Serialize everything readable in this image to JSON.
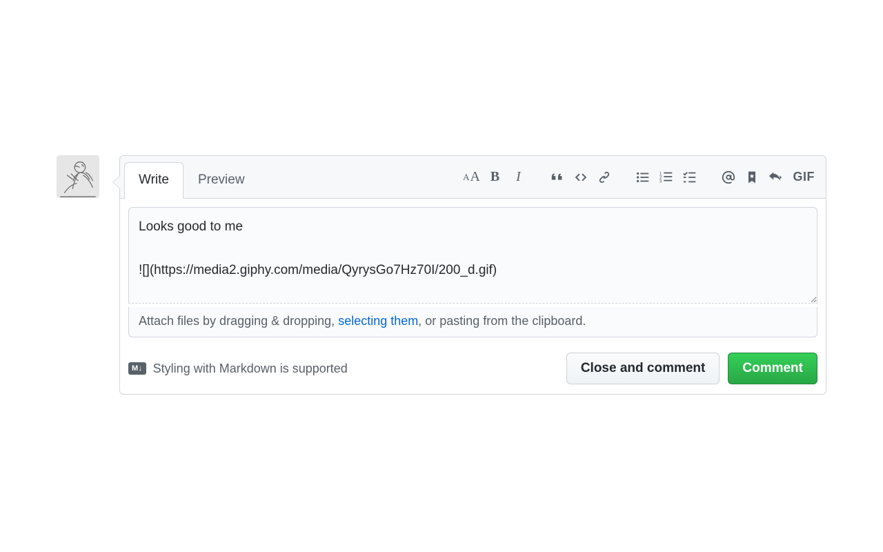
{
  "tabs": {
    "write": "Write",
    "preview": "Preview"
  },
  "toolbar": {
    "gif": "GIF"
  },
  "textarea": {
    "value": "Looks good to me\n\n![](https://media2.giphy.com/media/QyrysGo7Hz70I/200_d.gif)"
  },
  "attach": {
    "pre": "Attach files by dragging & dropping, ",
    "link": "selecting them",
    "post": ", or pasting from the clipboard."
  },
  "markdown": {
    "badge": "M↓",
    "text": "Styling with Markdown is supported"
  },
  "buttons": {
    "close": "Close and comment",
    "comment": "Comment"
  }
}
